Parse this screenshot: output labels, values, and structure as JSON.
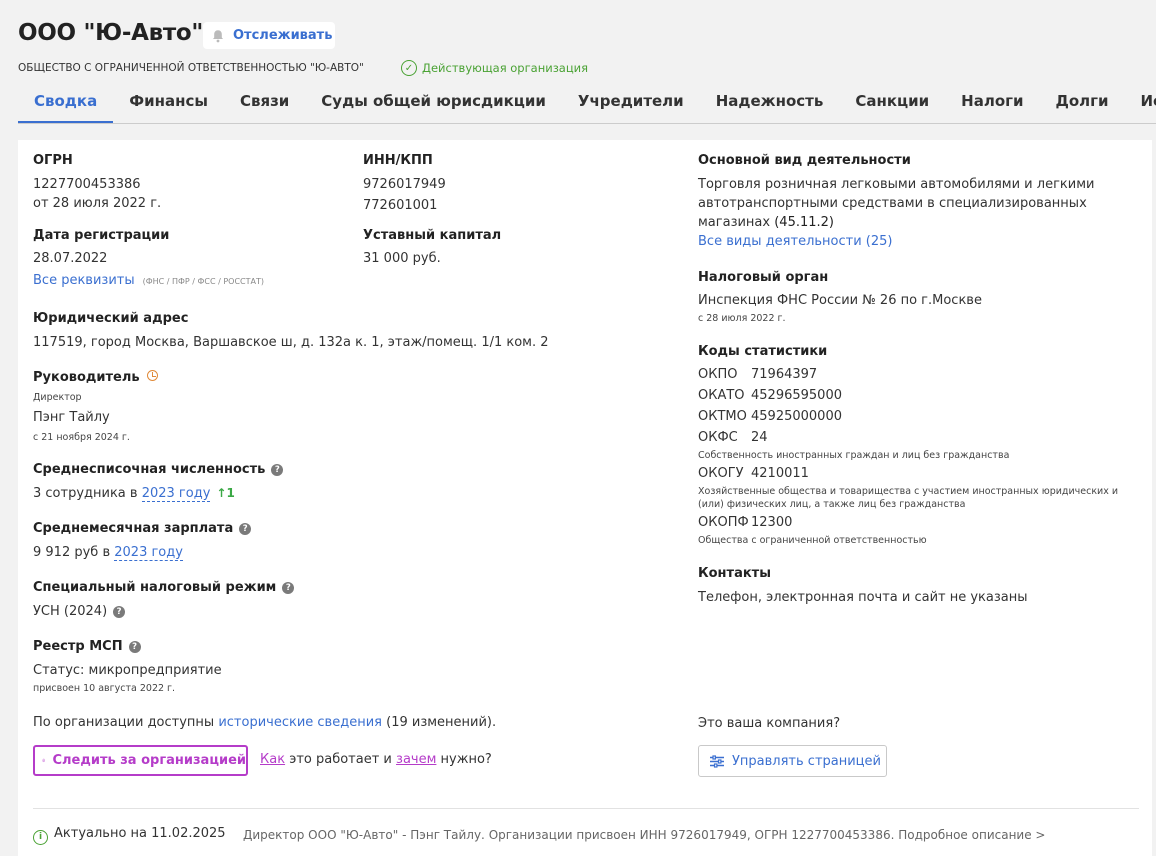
{
  "header": {
    "company_name": "ООО \"Ю-Авто\"",
    "follow_label": "Отслеживать",
    "full_name": "ОБЩЕСТВО С ОГРАНИЧЕННОЙ ОТВЕТСТВЕННОСТЬЮ \"Ю-АВТО\"",
    "status": "Действующая организация",
    "status_color": "#4aa234"
  },
  "tabs": [
    {
      "label": "Сводка",
      "active": true
    },
    {
      "label": "Финансы"
    },
    {
      "label": "Связи"
    },
    {
      "label": "Суды общей юрисдикции"
    },
    {
      "label": "Учредители"
    },
    {
      "label": "Надежность"
    },
    {
      "label": "Санкции"
    },
    {
      "label": "Налоги"
    },
    {
      "label": "Долги"
    },
    {
      "label": "История"
    }
  ],
  "ogrn": {
    "label": "ОГРН",
    "value": "1227700453386",
    "date": "от 28 июля 2022 г."
  },
  "inn_kpp": {
    "label": "ИНН/КПП",
    "inn": "9726017949",
    "kpp": "772601001"
  },
  "reg_date": {
    "label": "Дата регистрации",
    "value": "28.07.2022"
  },
  "capital": {
    "label": "Уставный капитал",
    "value": "31 000 руб."
  },
  "requisites": {
    "link": "Все реквизиты",
    "note": "(ФНС / ПФР / ФСС / РОССТАТ)"
  },
  "address": {
    "label": "Юридический адрес",
    "value": "117519, город Москва, Варшавское ш, д. 132а к. 1, этаж/помещ. 1/1 ком. 2"
  },
  "head": {
    "label": "Руководитель",
    "role": "Директор",
    "name": "Пэнг Тайлу",
    "since": "с 21 ноября 2024 г."
  },
  "employees": {
    "label": "Среднесписочная численность",
    "prefix": "3 сотрудника в",
    "year": "2023 году",
    "change": "↑1"
  },
  "salary": {
    "label": "Среднемесячная зарплата",
    "prefix": "9 912 руб в",
    "year": "2023 году"
  },
  "tax_regime": {
    "label": "Специальный налоговый режим",
    "value": "УСН (2024)"
  },
  "msp": {
    "label": "Реестр МСП",
    "status": "Статус: микропредприятие",
    "assigned": "присвоен 10 августа 2022 г."
  },
  "activity": {
    "label": "Основной вид деятельности",
    "line1": "Торговля розничная легковыми автомобилями и легкими",
    "line2": "автотранспортными средствами в специализированных",
    "line3": "магазинах",
    "code": "(45.11.2)",
    "all_link": "Все виды деятельности (25)"
  },
  "tax_authority": {
    "label": "Налоговый орган",
    "value": "Инспекция ФНС России № 26 по г.Москве",
    "since": "с 28 июля 2022 г."
  },
  "stats": {
    "label": "Коды статистики",
    "okpo_k": "ОКПО",
    "okpo_v": "71964397",
    "okato_k": "ОКАТО",
    "okato_v": "45296595000",
    "oktmo_k": "ОКТМО",
    "oktmo_v": "45925000000",
    "okfs_k": "ОКФС",
    "okfs_v": "24",
    "okfs_desc": "Собственность иностранных граждан и лиц без гражданства",
    "okogu_k": "ОКОГУ",
    "okogu_v": "4210011",
    "okogu_desc1": "Хозяйственные общества и товарищества с участием иностранных юридических и",
    "okogu_desc2": "(или) физических лиц, а также лиц без гражданства",
    "okopf_k": "ОКОПФ",
    "okopf_v": "12300",
    "okopf_desc": "Общества с ограниченной ответственностью"
  },
  "contacts": {
    "label": "Контакты",
    "value": "Телефон, электронная почта и сайт не указаны"
  },
  "history": {
    "prefix": "По организации доступны",
    "link": "исторические сведения",
    "suffix": "(19 изменений)."
  },
  "track_btn": "Следить за организацией",
  "how": {
    "link1": "Как",
    "mid": "это работает и",
    "link2": "зачем",
    "end": "нужно?"
  },
  "own_company": {
    "question": "Это ваша компания?",
    "button": "Управлять страницей"
  },
  "footer": {
    "actual": "Актуально на 11.02.2025",
    "description": "Директор ООО \"Ю-Авто\" - Пэнг Тайлу. Организации присвоен ИНН 9726017949, ОГРН 1227700453386. Подробное описание >"
  },
  "colors": {
    "accent": "#3a6fd0",
    "purple": "#b53cc9",
    "green": "#4aa234"
  }
}
